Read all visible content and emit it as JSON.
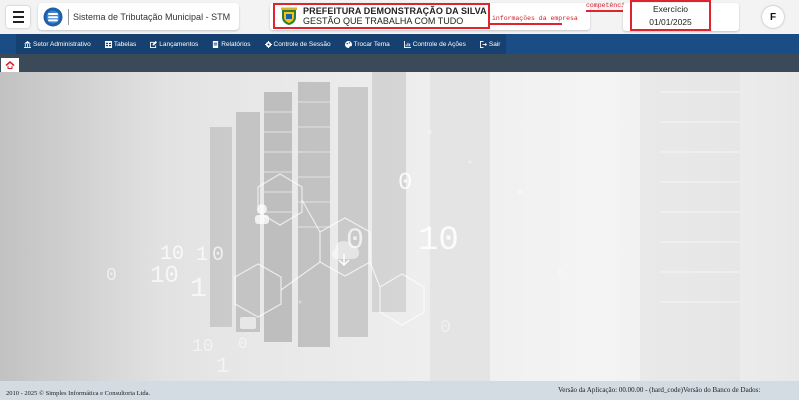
{
  "header": {
    "app_title": "Sistema de Tributação Municipal - STM",
    "company_name": "PREFEITURA DEMONSTRAÇÃO DA SILVA",
    "company_slogan": "GESTÃO QUE TRABALHA COM TUDO",
    "annotation_company": "informações da empresa",
    "annotation_period": "competência",
    "exercise_label": "Exercício",
    "exercise_date": "01/01/2025",
    "user_initial": "F"
  },
  "nav": {
    "items": [
      {
        "label": "Setor Administrativo",
        "icon": "bank-icon"
      },
      {
        "label": "Tabelas",
        "icon": "table-icon"
      },
      {
        "label": "Lançamentos",
        "icon": "edit-icon"
      },
      {
        "label": "Relatórios",
        "icon": "report-icon"
      },
      {
        "label": "Controle de Sessão",
        "icon": "gear-icon"
      },
      {
        "label": "Trocar Tema",
        "icon": "palette-icon"
      },
      {
        "label": "Controle de Ações",
        "icon": "chart-icon"
      },
      {
        "label": "Sair",
        "icon": "logout-icon"
      }
    ]
  },
  "background_digits": {
    "d1": "0",
    "d2": "10",
    "d3": "10",
    "d4": "1",
    "d5": "0",
    "d6": "0",
    "d7": "10",
    "d8": "1",
    "d9": "0",
    "d10": "10",
    "d11": "1",
    "d12": "0",
    "d13": "0"
  },
  "footer": {
    "copyright": "2010 - 2025 © Simples Informática e Consultoria Ltda.",
    "version": "Versão da Aplicação: 00.00.00 - (hard_code)Versão do Banco de Dados:"
  },
  "colors": {
    "nav_bg": "#1a4d86",
    "tab_bar_bg": "#3b4a58",
    "annotation_red": "#e0242f",
    "footer_bg": "#d3dbe3"
  }
}
